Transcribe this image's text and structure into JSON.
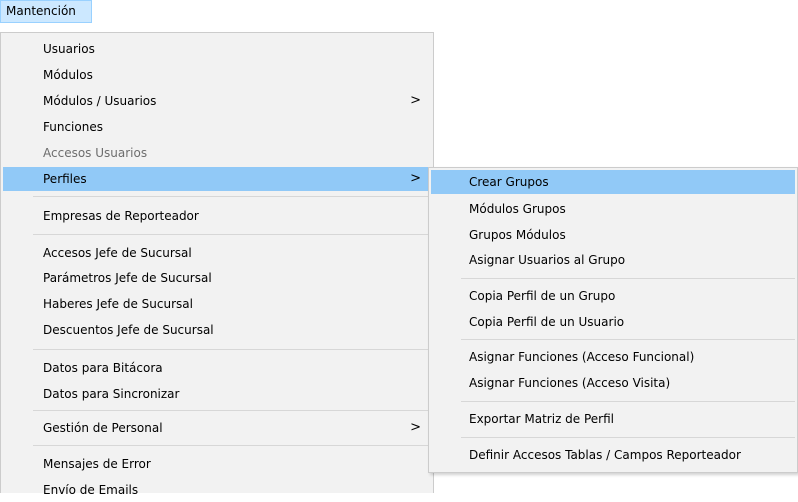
{
  "menubar": {
    "mantencion_label": "Mantención"
  },
  "main_menu": {
    "items": [
      {
        "label": "Usuarios"
      },
      {
        "label": "Módulos"
      },
      {
        "label": "Módulos / Usuarios",
        "arrow": ">"
      },
      {
        "label": "Funciones"
      },
      {
        "label": "Accesos Usuarios"
      },
      {
        "label": "Perfiles",
        "arrow": ">"
      },
      {
        "label": "Empresas de Reporteador"
      },
      {
        "label": "Accesos Jefe de Sucursal"
      },
      {
        "label": "Parámetros Jefe de Sucursal"
      },
      {
        "label": "Haberes Jefe de Sucursal"
      },
      {
        "label": "Descuentos Jefe de Sucursal"
      },
      {
        "label": "Datos para Bitácora"
      },
      {
        "label": "Datos para Sincronizar"
      },
      {
        "label": "Gestión de Personal",
        "arrow": ">"
      },
      {
        "label": "Mensajes de Error"
      },
      {
        "label": "Envío de Emails"
      }
    ]
  },
  "sub_menu": {
    "items": [
      {
        "label": "Crear Grupos"
      },
      {
        "label": "Módulos Grupos"
      },
      {
        "label": "Grupos Módulos"
      },
      {
        "label": "Asignar Usuarios al Grupo"
      },
      {
        "label": "Copia Perfil de un Grupo"
      },
      {
        "label": "Copia Perfil de un Usuario"
      },
      {
        "label": "Asignar Funciones (Acceso Funcional)"
      },
      {
        "label": "Asignar Funciones (Acceso Visita)"
      },
      {
        "label": "Exportar Matriz de Perfil"
      },
      {
        "label": "Definir Accesos Tablas / Campos Reporteador"
      }
    ]
  },
  "colors": {
    "highlight": "#91c9f7",
    "menubar_selected": "#cce8ff",
    "menu_background": "#f2f2f2",
    "disabled_text": "#6d6d6d"
  },
  "icons": {
    "submenu_arrow": "chevron-right-icon"
  }
}
